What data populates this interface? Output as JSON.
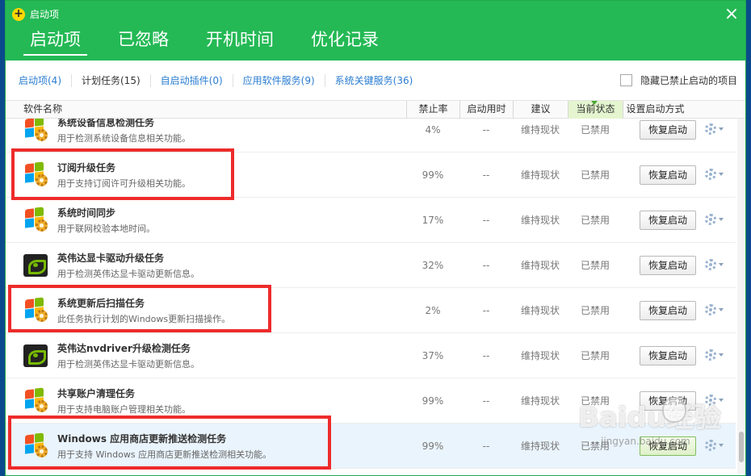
{
  "window": {
    "title": "启动项",
    "close_glyph": "×"
  },
  "main_tabs": [
    {
      "label": "启动项",
      "active": true
    },
    {
      "label": "已忽略",
      "active": false
    },
    {
      "label": "开机时间",
      "active": false
    },
    {
      "label": "优化记录",
      "active": false
    }
  ],
  "sub_tabs": [
    {
      "label": "启动项(4)",
      "active": false
    },
    {
      "label": "计划任务(15)",
      "active": true
    },
    {
      "label": "自启动插件(0)",
      "active": false
    },
    {
      "label": "应用软件服务(9)",
      "active": false
    },
    {
      "label": "系统关键服务(36)",
      "active": false
    }
  ],
  "hide_disabled": {
    "label": "隐藏已禁止启动的项目",
    "checked": false
  },
  "columns": {
    "name": "软件名称",
    "rate": "禁止率",
    "time": "启动用时",
    "advice": "建议",
    "state": "当前状态",
    "action": "设置启动方式"
  },
  "rows": [
    {
      "icon": "windows-gear-icon",
      "title": "系统设备信息检测任务",
      "desc": "用于检测系统设备信息相关功能。",
      "rate": "4%",
      "time": "--",
      "advice": "维持现状",
      "state": "已禁用",
      "button": "恢复启动",
      "selected": false
    },
    {
      "icon": "windows-gear-icon",
      "title": "订阅升级任务",
      "desc": "用于支持订阅许可升级相关功能。",
      "rate": "99%",
      "time": "--",
      "advice": "维持现状",
      "state": "已禁用",
      "button": "恢复启动",
      "selected": false
    },
    {
      "icon": "windows-gear-icon",
      "title": "系统时间同步",
      "desc": "用于联网校验本地时间。",
      "rate": "17%",
      "time": "--",
      "advice": "维持现状",
      "state": "已禁用",
      "button": "恢复启动",
      "selected": false
    },
    {
      "icon": "nvidia-icon",
      "title": "英伟达显卡驱动升级任务",
      "desc": "用于检测英伟达显卡驱动更新信息。",
      "rate": "32%",
      "time": "--",
      "advice": "维持现状",
      "state": "已禁用",
      "button": "恢复启动",
      "selected": false
    },
    {
      "icon": "windows-gear-icon",
      "title": "系统更新后扫描任务",
      "desc": "此任务执行计划的Windows更新扫描操作。",
      "rate": "2%",
      "time": "--",
      "advice": "维持现状",
      "state": "已禁用",
      "button": "恢复启动",
      "selected": false
    },
    {
      "icon": "nvidia-icon",
      "title": "英伟达nvdriver升级检测任务",
      "desc": "用于检测英伟达显卡驱动更新信息。",
      "rate": "37%",
      "time": "--",
      "advice": "维持现状",
      "state": "已禁用",
      "button": "恢复启动",
      "selected": false
    },
    {
      "icon": "windows-gear-icon",
      "title": "共享账户清理任务",
      "desc": "用于支持电脑账户管理相关功能。",
      "rate": "99%",
      "time": "--",
      "advice": "维持现状",
      "state": "已禁用",
      "button": "恢复启动",
      "selected": false
    },
    {
      "icon": "windows-gear-icon",
      "title": "Windows 应用商店更新推送检测任务",
      "desc": "用于支持 Windows 应用商店更新推送检测相关功能。",
      "rate": "99%",
      "time": "--",
      "advice": "维持现状",
      "state": "已禁用",
      "button": "恢复启动",
      "selected": true
    }
  ],
  "watermark": {
    "logo_text": "Baidu经验",
    "url": "jingyan.baidu.com"
  },
  "colors": {
    "header_green": "#24b955",
    "link_blue": "#2a7dd1",
    "highlight_red": "#ee2b2b"
  }
}
